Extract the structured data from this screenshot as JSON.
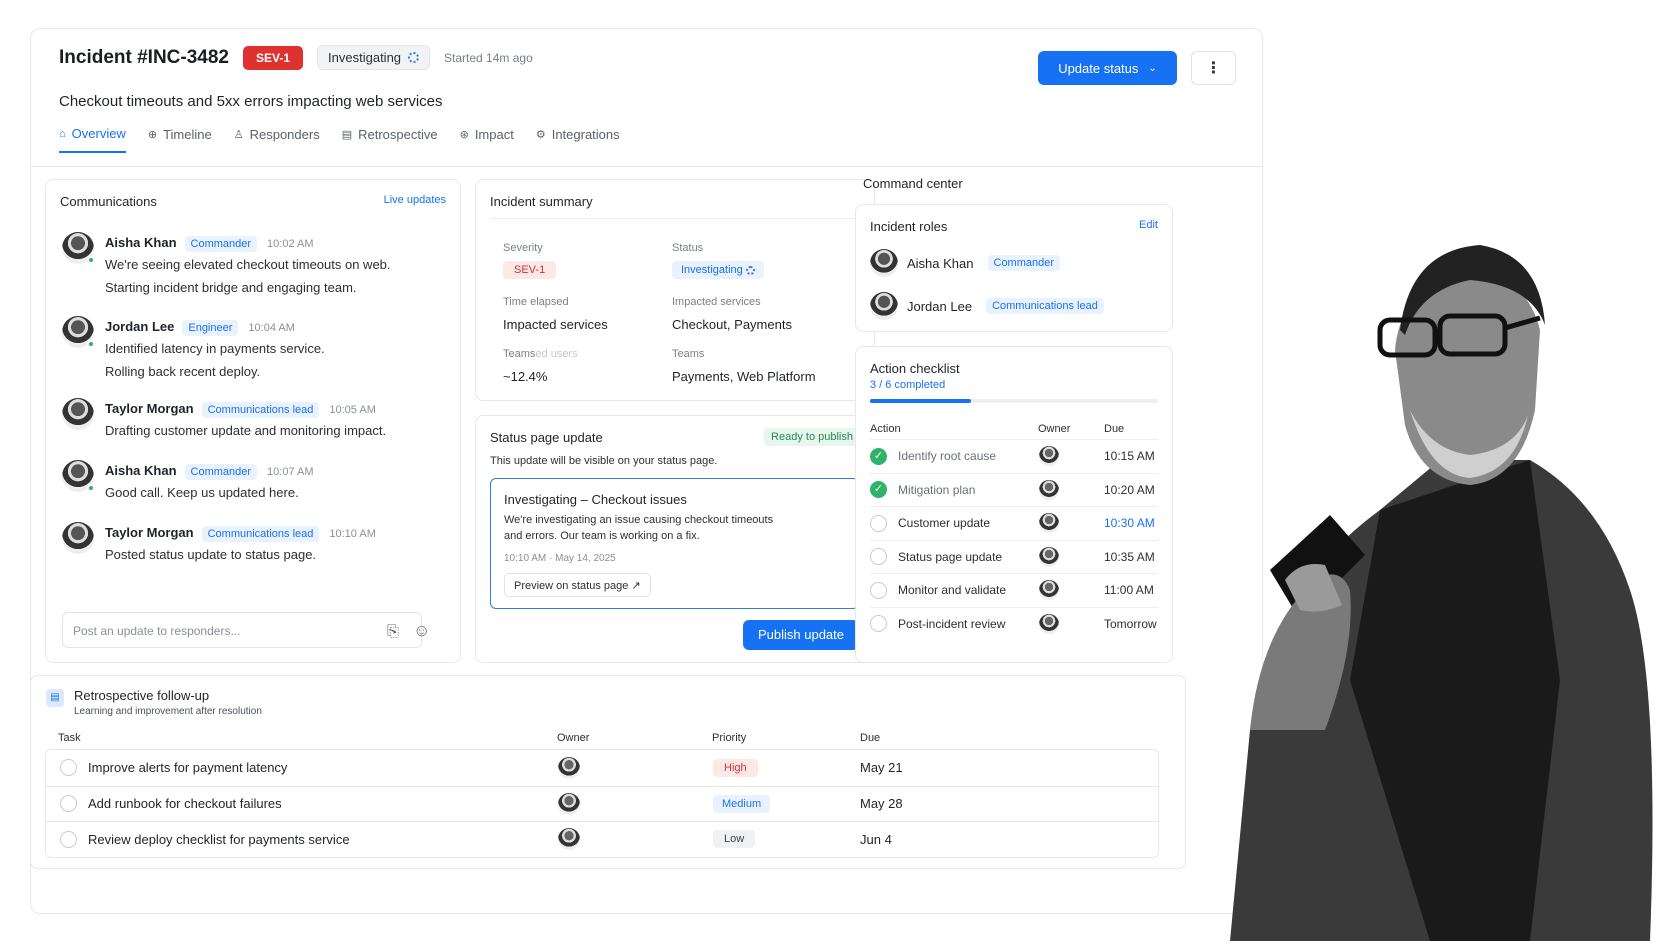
{
  "header": {
    "title": "Incident #INC-3482",
    "severity": "SEV-1",
    "status": "Investigating",
    "started": "Started 14m ago",
    "subtitle": "Checkout timeouts and 5xx errors impacting web services",
    "update_label": "Update status",
    "more_label": "⋮"
  },
  "tabs": [
    {
      "label": "Overview",
      "icon": "home-icon"
    },
    {
      "label": "Timeline",
      "icon": "timeline-icon"
    },
    {
      "label": "Responders",
      "icon": "users-icon"
    },
    {
      "label": "Retrospective",
      "icon": "document-icon"
    },
    {
      "label": "Impact",
      "icon": "globe-icon"
    },
    {
      "label": "Integrations",
      "icon": "plug-icon"
    }
  ],
  "communications": {
    "title": "Communications",
    "live": "Live updates",
    "placeholder": "Post an update to responders...",
    "messages": [
      {
        "name": "Aisha Khan",
        "role": "Commander",
        "time": "10:02 AM",
        "lines": [
          "We're seeing elevated checkout timeouts on web.",
          "Starting incident bridge and engaging team."
        ]
      },
      {
        "name": "Jordan Lee",
        "role": "Engineer",
        "time": "10:04 AM",
        "lines": [
          "Identified latency in payments service.",
          "Rolling back recent deploy."
        ]
      },
      {
        "name": "Taylor Morgan",
        "role": "Communications lead",
        "time": "10:05 AM",
        "lines": [
          "Drafting customer update and monitoring impact."
        ]
      },
      {
        "name": "Aisha Khan",
        "role": "Commander",
        "time": "10:07 AM",
        "lines": [
          "Good call. Keep us updated here."
        ]
      },
      {
        "name": "Taylor Morgan",
        "role": "Communications lead",
        "time": "10:10 AM",
        "lines": [
          "Posted status update to status page."
        ]
      }
    ]
  },
  "summary": {
    "title": "Incident summary",
    "severity_label": "Severity",
    "severity": "SEV-1",
    "status_label": "Status",
    "status": "Investigating",
    "time_label": "Time elapsed",
    "time_value": "Impacted services",
    "impacted_label": "Impacted services",
    "impacted": "Checkout, Payments",
    "teams_label": "Teams",
    "teams_label2": "ed users",
    "teams_value": "~12.4%",
    "teams2_label": "Teams",
    "teams2": "Payments, Web Platform"
  },
  "statuspage": {
    "title": "Status page update",
    "ready": "Ready to publish",
    "desc": "This update will be visible on your status page.",
    "box_title": "Investigating – Checkout issues",
    "box_line1": "We're investigating an issue causing checkout timeouts",
    "box_line2": "and errors. Our team is working on a fix.",
    "box_time": "10:10 AM · May 14, 2025",
    "preview": "Preview on status page",
    "publish": "Publish update"
  },
  "command": {
    "title": "Command center",
    "roles_title": "Incident roles",
    "edit": "Edit",
    "roles": [
      {
        "name": "Aisha Khan",
        "role": "Commander"
      },
      {
        "name": "Jordan Lee",
        "role": "Communications lead"
      }
    ],
    "checklist_title": "Action checklist",
    "progress_text": "3 / 6 completed",
    "progress": 0.35,
    "cols": [
      "Action",
      "Owner",
      "Due"
    ],
    "items": [
      {
        "action": "Identify root cause",
        "due": "10:15 AM",
        "done": true
      },
      {
        "action": "Mitigation plan",
        "due": "10:20 AM",
        "done": true
      },
      {
        "action": "Customer update",
        "due": "10:30 AM",
        "done": false
      },
      {
        "action": "Status page update",
        "due": "10:35 AM",
        "done": false
      },
      {
        "action": "Monitor and validate",
        "due": "11:00 AM",
        "done": false
      },
      {
        "action": "Post-incident review",
        "due": "Tomorrow",
        "done": false
      }
    ]
  },
  "retro": {
    "title": "Retrospective follow-up",
    "subtitle": "Learning and improvement after resolution",
    "cols": [
      "Task",
      "Owner",
      "Priority",
      "Due"
    ],
    "rows": [
      {
        "task": "Improve alerts for payment latency",
        "priority": "High",
        "due": "May 21"
      },
      {
        "task": "Add runbook for checkout failures",
        "priority": "Medium",
        "due": "May 28"
      },
      {
        "task": "Review deploy checklist for payments service",
        "priority": "Low",
        "due": "Jun 4"
      }
    ]
  }
}
